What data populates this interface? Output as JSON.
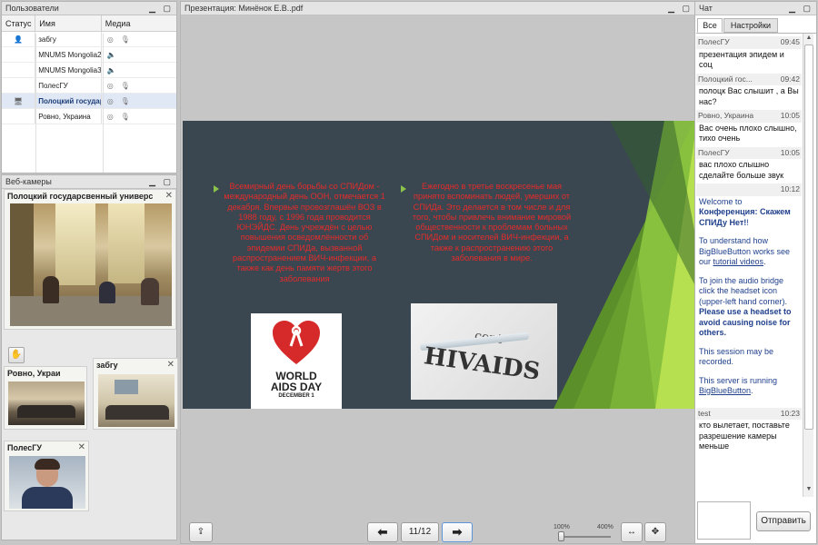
{
  "users_panel": {
    "title": "Пользователи",
    "columns": {
      "status": "Статус",
      "name": "Имя",
      "media": "Медиа"
    },
    "users": [
      {
        "name": "забгу",
        "status_icon": "user-icon",
        "media_icons": [
          "webcam-icon",
          "microphone-icon"
        ]
      },
      {
        "name": "MNUMS Mongolia2",
        "status_icon": "",
        "media_icons": [
          "speaker-icon"
        ]
      },
      {
        "name": "MNUMS Mongolia3",
        "status_icon": "",
        "media_icons": [
          "speaker-icon"
        ]
      },
      {
        "name": "ПолесГУ",
        "status_icon": "",
        "media_icons": [
          "webcam-icon",
          "microphone-icon"
        ]
      },
      {
        "name": "Полоцкий государ",
        "status_icon": "presenter-icon",
        "media_icons": [
          "webcam-icon",
          "microphone-active-icon"
        ]
      },
      {
        "name": "Ровно, Украина",
        "status_icon": "",
        "media_icons": [
          "webcam-icon",
          "microphone-icon"
        ]
      }
    ]
  },
  "webcams_panel": {
    "title": "Веб-камеры",
    "main_cam": {
      "title": "Полоцкий государсвенный универс"
    },
    "small_cams": [
      {
        "title": "Ровно, Украи"
      },
      {
        "title": "забгу"
      },
      {
        "title": "ПолесГУ"
      }
    ],
    "raise_hand_icon": "raise-hand-icon"
  },
  "presentation": {
    "title": "Презентация: Минёнок Е.В..pdf",
    "page_indicator": "11/12",
    "zoom_min_label": "100%",
    "zoom_max_label": "400%",
    "zoom_level": 0.0,
    "slide": {
      "left_text": "Всемирный день борьбы со СПИДом - международный день ООН, отмечается 1 декабря. Впервые провозглашён ВОЗ в 1988 году, с 1996 года проводится ЮНЭЙДС. День учреждён с целью повышения осведомлённости об эпидемии СПИДа, вызванной распространением ВИЧ-инфекции, а также как день памяти жертв этого заболевания",
      "right_text": "Ежегодно в третье воскресенье мая принято вспоминать людей, умерших от СПИДа. Это делается в том числе и для того, чтобы привлечь внимание мировой общественности к проблемам больных СПИДом и носителей ВИЧ-инфекции, а также к распространению этого заболевания в мире.",
      "poster_line1": "WORLD",
      "poster_line2": "AIDS DAY",
      "poster_line3": "DECEMBER 1",
      "photo_text": "HIVAIDS",
      "photo_small_text": "cent"
    },
    "colors": {
      "slide_bg": "#3a4750",
      "text": "#e52b2b",
      "accent_green": "#8bc34a"
    }
  },
  "chat": {
    "title": "Чат",
    "tabs": [
      "Все",
      "Настройки"
    ],
    "messages": [
      {
        "sender": "ПолесГУ",
        "time": "09:45",
        "text": "презентация эпидем и соц"
      },
      {
        "sender": "Полоцкий гос...",
        "time": "09:42",
        "text": "полоцк Вас слышит , а Вы нас?"
      },
      {
        "sender": "Ровно, Украина",
        "time": "10:05",
        "text": "Вас очень плохо слышно, тихо очень"
      },
      {
        "sender": "ПолесГУ",
        "time": "10:05",
        "text": "вас плохо слышно сделайте больше звук"
      },
      {
        "sender": "",
        "time": "10:12",
        "text": ""
      }
    ],
    "welcome": {
      "p1_prefix": "Welcome to",
      "p1_bold": "Конференция: Скажем СПИДу Нет!",
      "p1_suffix": "!",
      "p2_text": "To understand how BigBlueButton works see our",
      "p2_link": "tutorial videos",
      "p3_text": "To join the audio bridge click the headset icon (upper-left hand corner).",
      "p3_bold": "Please use a headset to avoid causing noise for others.",
      "p4_text": "This session may be recorded.",
      "p5_text": "This server is running",
      "p5_link": "BigBlueButton"
    },
    "last_message": {
      "sender": "test",
      "time": "10:23",
      "text": "кто вылетает, поставьте разрешение камеры меньше"
    },
    "send_button": "Отправить",
    "input_value": ""
  }
}
